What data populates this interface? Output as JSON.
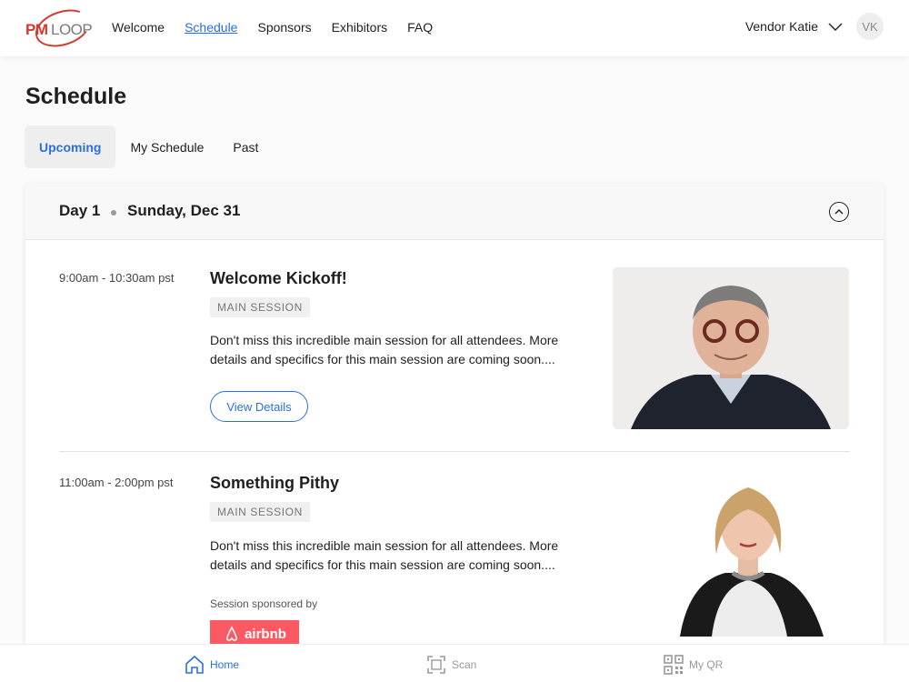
{
  "brand": {
    "logo_pm": "PM",
    "logo_loop": "LOOP",
    "accent": "#2a6fdc",
    "logo_red": "#d23a2e"
  },
  "nav": {
    "links": [
      "Welcome",
      "Schedule",
      "Sponsors",
      "Exhibitors",
      "FAQ"
    ],
    "active": "Schedule",
    "user_name": "Vendor Katie",
    "user_initials": "VK"
  },
  "page": {
    "title": "Schedule"
  },
  "tabs": {
    "items": [
      "Upcoming",
      "My Schedule",
      "Past"
    ],
    "active": "Upcoming"
  },
  "day": {
    "label": "Day 1",
    "date": "Sunday, Dec 31"
  },
  "sessions": [
    {
      "time": "9:00am - 10:30am pst",
      "title": "Welcome Kickoff!",
      "tag": "MAIN SESSION",
      "description": "Don't miss this incredible main session for all attendees. More details and specifics for this main session are coming soon....",
      "button": "View Details"
    },
    {
      "time": "11:00am - 2:00pm pst",
      "title": "Something Pithy",
      "tag": "MAIN SESSION",
      "description": "Don't miss this incredible main session for all attendees. More details and specifics for this main session are coming soon....",
      "sponsor_label": "Session sponsored by",
      "sponsor_name": "airbnb"
    }
  ],
  "bottom_bar": {
    "items": [
      "Home",
      "Scan",
      "My QR"
    ],
    "active": "Home"
  }
}
